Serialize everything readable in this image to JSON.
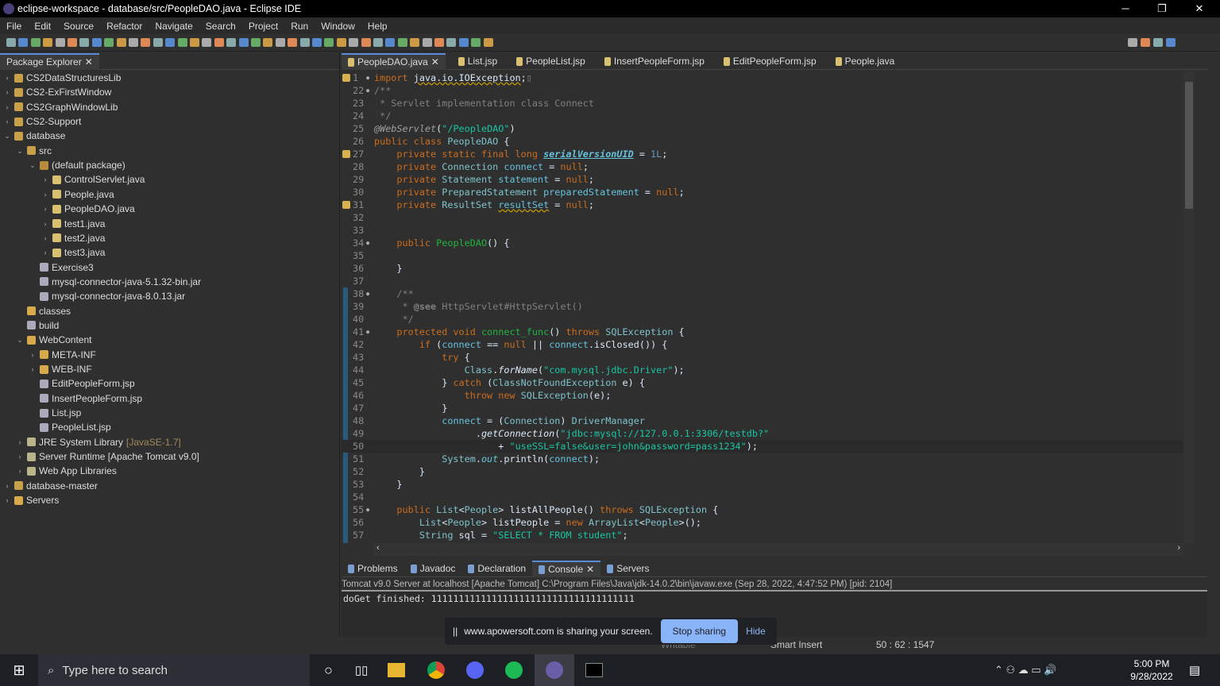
{
  "window": {
    "title": "eclipse-workspace - database/src/PeopleDAO.java - Eclipse IDE",
    "minimize": "─",
    "maximize": "❐",
    "close": "✕"
  },
  "menu": [
    "File",
    "Edit",
    "Source",
    "Refactor",
    "Navigate",
    "Search",
    "Project",
    "Run",
    "Window",
    "Help"
  ],
  "package_explorer": {
    "title": "Package Explorer",
    "items": [
      {
        "label": "CS2DataStructuresLib",
        "level": 0,
        "toggle": "›",
        "icon": "project"
      },
      {
        "label": "CS2-ExFirstWindow",
        "level": 0,
        "toggle": "›",
        "icon": "project"
      },
      {
        "label": "CS2GraphWindowLib",
        "level": 0,
        "toggle": "›",
        "icon": "project"
      },
      {
        "label": "CS2-Support",
        "level": 0,
        "toggle": "›",
        "icon": "project"
      },
      {
        "label": "database",
        "level": 0,
        "toggle": "⌄",
        "icon": "project"
      },
      {
        "label": "src",
        "level": 1,
        "toggle": "⌄",
        "icon": "src-folder"
      },
      {
        "label": "(default package)",
        "level": 2,
        "toggle": "⌄",
        "icon": "package"
      },
      {
        "label": "ControlServlet.java",
        "level": 3,
        "toggle": "›",
        "icon": "java"
      },
      {
        "label": "People.java",
        "level": 3,
        "toggle": "›",
        "icon": "java"
      },
      {
        "label": "PeopleDAO.java",
        "level": 3,
        "toggle": "›",
        "icon": "java"
      },
      {
        "label": "test1.java",
        "level": 3,
        "toggle": "›",
        "icon": "java"
      },
      {
        "label": "test2.java",
        "level": 3,
        "toggle": "›",
        "icon": "java"
      },
      {
        "label": "test3.java",
        "level": 3,
        "toggle": "›",
        "icon": "java"
      },
      {
        "label": "Exercise3",
        "level": 2,
        "toggle": "",
        "icon": "file"
      },
      {
        "label": "mysql-connector-java-5.1.32-bin.jar",
        "level": 2,
        "toggle": "",
        "icon": "file"
      },
      {
        "label": "mysql-connector-java-8.0.13.jar",
        "level": 2,
        "toggle": "",
        "icon": "file"
      },
      {
        "label": "classes",
        "level": 1,
        "toggle": "",
        "icon": "folder"
      },
      {
        "label": "build",
        "level": 1,
        "toggle": "",
        "icon": "file"
      },
      {
        "label": "WebContent",
        "level": 1,
        "toggle": "⌄",
        "icon": "folder"
      },
      {
        "label": "META-INF",
        "level": 2,
        "toggle": "›",
        "icon": "folder"
      },
      {
        "label": "WEB-INF",
        "level": 2,
        "toggle": "›",
        "icon": "folder"
      },
      {
        "label": "EditPeopleForm.jsp",
        "level": 2,
        "toggle": "",
        "icon": "file"
      },
      {
        "label": "InsertPeopleForm.jsp",
        "level": 2,
        "toggle": "",
        "icon": "file"
      },
      {
        "label": "List.jsp",
        "level": 2,
        "toggle": "",
        "icon": "file"
      },
      {
        "label": "PeopleList.jsp",
        "level": 2,
        "toggle": "",
        "icon": "file"
      },
      {
        "label": "JRE System Library",
        "deco": "[JavaSE-1.7]",
        "level": 1,
        "toggle": "›",
        "icon": "library"
      },
      {
        "label": "Server Runtime [Apache Tomcat v9.0]",
        "level": 1,
        "toggle": "›",
        "icon": "library"
      },
      {
        "label": "Web App Libraries",
        "level": 1,
        "toggle": "›",
        "icon": "library"
      },
      {
        "label": "database-master",
        "level": 0,
        "toggle": "›",
        "icon": "project"
      },
      {
        "label": "Servers",
        "level": 0,
        "toggle": "›",
        "icon": "folder"
      }
    ]
  },
  "editor_tabs": [
    {
      "label": "PeopleDAO.java",
      "active": true
    },
    {
      "label": "List.jsp"
    },
    {
      "label": "PeopleList.jsp"
    },
    {
      "label": "InsertPeopleForm.jsp"
    },
    {
      "label": "EditPeopleForm.jsp"
    },
    {
      "label": "People.java"
    }
  ],
  "code": [
    {
      "n": "1",
      "m": "●",
      "w": true,
      "t": [
        [
          "kw",
          "import "
        ],
        [
          "pl sq",
          "java.io.IOException"
        ],
        [
          "pl",
          ";"
        ],
        [
          "cm",
          "▯"
        ]
      ]
    },
    {
      "n": "22",
      "m": "●",
      "t": [
        [
          "cm",
          "/**"
        ]
      ]
    },
    {
      "n": "23",
      "t": [
        [
          "cm",
          " * Servlet implementation class Connect"
        ]
      ]
    },
    {
      "n": "24",
      "t": [
        [
          "cm",
          " */"
        ]
      ]
    },
    {
      "n": "25",
      "t": [
        [
          "an",
          "@WebServlet"
        ],
        [
          "pl",
          "("
        ],
        [
          "str",
          "\"/PeopleDAO\""
        ],
        [
          "pl",
          ")"
        ]
      ]
    },
    {
      "n": "26",
      "t": [
        [
          "kw",
          "public class "
        ],
        [
          "ty",
          "PeopleDAO"
        ],
        [
          "pl",
          " {"
        ]
      ]
    },
    {
      "n": "27",
      "w": true,
      "t": [
        [
          "kw",
          "    private static final long "
        ],
        [
          "sv",
          "serialVersionUID"
        ],
        [
          "pl",
          " = "
        ],
        [
          "num",
          "1L"
        ],
        [
          "pl",
          ";"
        ]
      ]
    },
    {
      "n": "28",
      "t": [
        [
          "kw",
          "    private "
        ],
        [
          "ty",
          "Connection "
        ],
        [
          "fv",
          "connect"
        ],
        [
          "pl",
          " = "
        ],
        [
          "kw",
          "null"
        ],
        [
          "pl",
          ";"
        ]
      ]
    },
    {
      "n": "29",
      "t": [
        [
          "kw",
          "    private "
        ],
        [
          "ty",
          "Statement "
        ],
        [
          "fv",
          "statement"
        ],
        [
          "pl",
          " = "
        ],
        [
          "kw",
          "null"
        ],
        [
          "pl",
          ";"
        ]
      ]
    },
    {
      "n": "30",
      "t": [
        [
          "kw",
          "    private "
        ],
        [
          "ty",
          "PreparedStatement "
        ],
        [
          "fv",
          "preparedStatement"
        ],
        [
          "pl",
          " = "
        ],
        [
          "kw",
          "null"
        ],
        [
          "pl",
          ";"
        ]
      ]
    },
    {
      "n": "31",
      "w": true,
      "t": [
        [
          "kw",
          "    private "
        ],
        [
          "ty",
          "ResultSet "
        ],
        [
          "fv sq",
          "resultSet"
        ],
        [
          "pl",
          " = "
        ],
        [
          "kw",
          "null"
        ],
        [
          "pl",
          ";"
        ]
      ]
    },
    {
      "n": "32",
      "t": []
    },
    {
      "n": "33",
      "t": []
    },
    {
      "n": "34",
      "m": "●",
      "t": [
        [
          "kw",
          "    public "
        ],
        [
          "mt",
          "PeopleDAO"
        ],
        [
          "pl",
          "() {"
        ]
      ]
    },
    {
      "n": "35",
      "t": []
    },
    {
      "n": "36",
      "t": [
        [
          "pl",
          "    }"
        ]
      ]
    },
    {
      "n": "37",
      "t": []
    },
    {
      "n": "38",
      "m": "●",
      "t": [
        [
          "cm",
          "    /**"
        ]
      ]
    },
    {
      "n": "39",
      "t": [
        [
          "cm",
          "     * "
        ],
        [
          "cm bold",
          "@see "
        ],
        [
          "cm",
          "HttpServlet#HttpServlet()"
        ]
      ]
    },
    {
      "n": "40",
      "t": [
        [
          "cm",
          "     */"
        ]
      ]
    },
    {
      "n": "41",
      "m": "●",
      "t": [
        [
          "kw",
          "    protected void "
        ],
        [
          "mt",
          "connect_func"
        ],
        [
          "pl",
          "() "
        ],
        [
          "kw",
          "throws "
        ],
        [
          "ty",
          "SQLException"
        ],
        [
          "pl",
          " {"
        ]
      ]
    },
    {
      "n": "42",
      "t": [
        [
          "kw",
          "        if "
        ],
        [
          "pl",
          "("
        ],
        [
          "fv",
          "connect"
        ],
        [
          "pl",
          " == "
        ],
        [
          "kw",
          "null"
        ],
        [
          "pl",
          " || "
        ],
        [
          "fv",
          "connect"
        ],
        [
          "pl",
          ".isClosed()) {"
        ]
      ]
    },
    {
      "n": "43",
      "t": [
        [
          "kw",
          "            try "
        ],
        [
          "pl",
          "{"
        ]
      ]
    },
    {
      "n": "44",
      "t": [
        [
          "ty",
          "                Class"
        ],
        [
          "pl",
          "."
        ],
        [
          "pl it",
          "forName"
        ],
        [
          "pl",
          "("
        ],
        [
          "str",
          "\"com.mysql.jdbc.Driver\""
        ],
        [
          "pl",
          ");"
        ]
      ]
    },
    {
      "n": "45",
      "t": [
        [
          "pl",
          "            } "
        ],
        [
          "kw",
          "catch "
        ],
        [
          "pl",
          "("
        ],
        [
          "ty",
          "ClassNotFoundException "
        ],
        [
          "pl",
          "e) {"
        ]
      ]
    },
    {
      "n": "46",
      "t": [
        [
          "kw",
          "                throw new "
        ],
        [
          "ty",
          "SQLException"
        ],
        [
          "pl",
          "(e);"
        ]
      ]
    },
    {
      "n": "47",
      "t": [
        [
          "pl",
          "            }"
        ]
      ]
    },
    {
      "n": "48",
      "t": [
        [
          "pl",
          "            "
        ],
        [
          "fv",
          "connect"
        ],
        [
          "pl",
          " = ("
        ],
        [
          "ty",
          "Connection"
        ],
        [
          "pl",
          ") "
        ],
        [
          "ty",
          "DriverManager"
        ]
      ]
    },
    {
      "n": "49",
      "t": [
        [
          "pl",
          "                  ."
        ],
        [
          "pl it",
          "getConnection"
        ],
        [
          "pl",
          "("
        ],
        [
          "str",
          "\"jdbc:mysql://127.0.0.1:3306/testdb?\""
        ]
      ]
    },
    {
      "n": "50",
      "hl": true,
      "t": [
        [
          "pl",
          "                      + "
        ],
        [
          "str",
          "\"useSSL=false&user=john&password=pass1234\""
        ],
        [
          "pl",
          ");"
        ]
      ]
    },
    {
      "n": "51",
      "t": [
        [
          "ty",
          "            System"
        ],
        [
          "pl",
          "."
        ],
        [
          "fv it",
          "out"
        ],
        [
          "pl",
          ".println("
        ],
        [
          "fv",
          "connect"
        ],
        [
          "pl",
          ");"
        ]
      ]
    },
    {
      "n": "52",
      "t": [
        [
          "pl",
          "        }"
        ]
      ]
    },
    {
      "n": "53",
      "t": [
        [
          "pl",
          "    }"
        ]
      ]
    },
    {
      "n": "54",
      "t": []
    },
    {
      "n": "55",
      "m": "●",
      "t": [
        [
          "kw",
          "    public "
        ],
        [
          "ty",
          "List"
        ],
        [
          "pl",
          "<"
        ],
        [
          "ty",
          "People"
        ],
        [
          "pl",
          "> listAllPeople() "
        ],
        [
          "kw",
          "throws "
        ],
        [
          "ty",
          "SQLException"
        ],
        [
          "pl",
          " {"
        ]
      ]
    },
    {
      "n": "56",
      "t": [
        [
          "ty",
          "        List"
        ],
        [
          "pl",
          "<"
        ],
        [
          "ty",
          "People"
        ],
        [
          "pl",
          "> listPeople = "
        ],
        [
          "kw",
          "new "
        ],
        [
          "ty",
          "ArrayList"
        ],
        [
          "pl",
          "<"
        ],
        [
          "ty",
          "People"
        ],
        [
          "pl",
          ">();"
        ]
      ]
    },
    {
      "n": "57",
      "t": [
        [
          "ty",
          "        String "
        ],
        [
          "pl",
          "sql = "
        ],
        [
          "str",
          "\"SELECT * FROM student\""
        ],
        [
          "pl",
          ";"
        ]
      ]
    }
  ],
  "bottom_tabs": [
    {
      "label": "Problems"
    },
    {
      "label": "Javadoc"
    },
    {
      "label": "Declaration"
    },
    {
      "label": "Console",
      "active": true
    },
    {
      "label": "Servers"
    }
  ],
  "console": {
    "header": "Tomcat v9.0 Server at localhost [Apache Tomcat] C:\\Program Files\\Java\\jdk-14.0.2\\bin\\javaw.exe  (Sep 28, 2022, 4:47:52 PM) [pid: 2104]",
    "output": "doGet finished: 1111111111111111111111111111111111111"
  },
  "status": {
    "writable": "Writable",
    "insert_mode": "Smart Insert",
    "position": "50 : 62 : 1547"
  },
  "share_bar": {
    "message": "www.apowersoft.com is sharing your screen.",
    "stop": "Stop sharing",
    "hide": "Hide"
  },
  "taskbar": {
    "search_placeholder": "Type here to search",
    "time": "5:00 PM",
    "date": "9/28/2022"
  }
}
